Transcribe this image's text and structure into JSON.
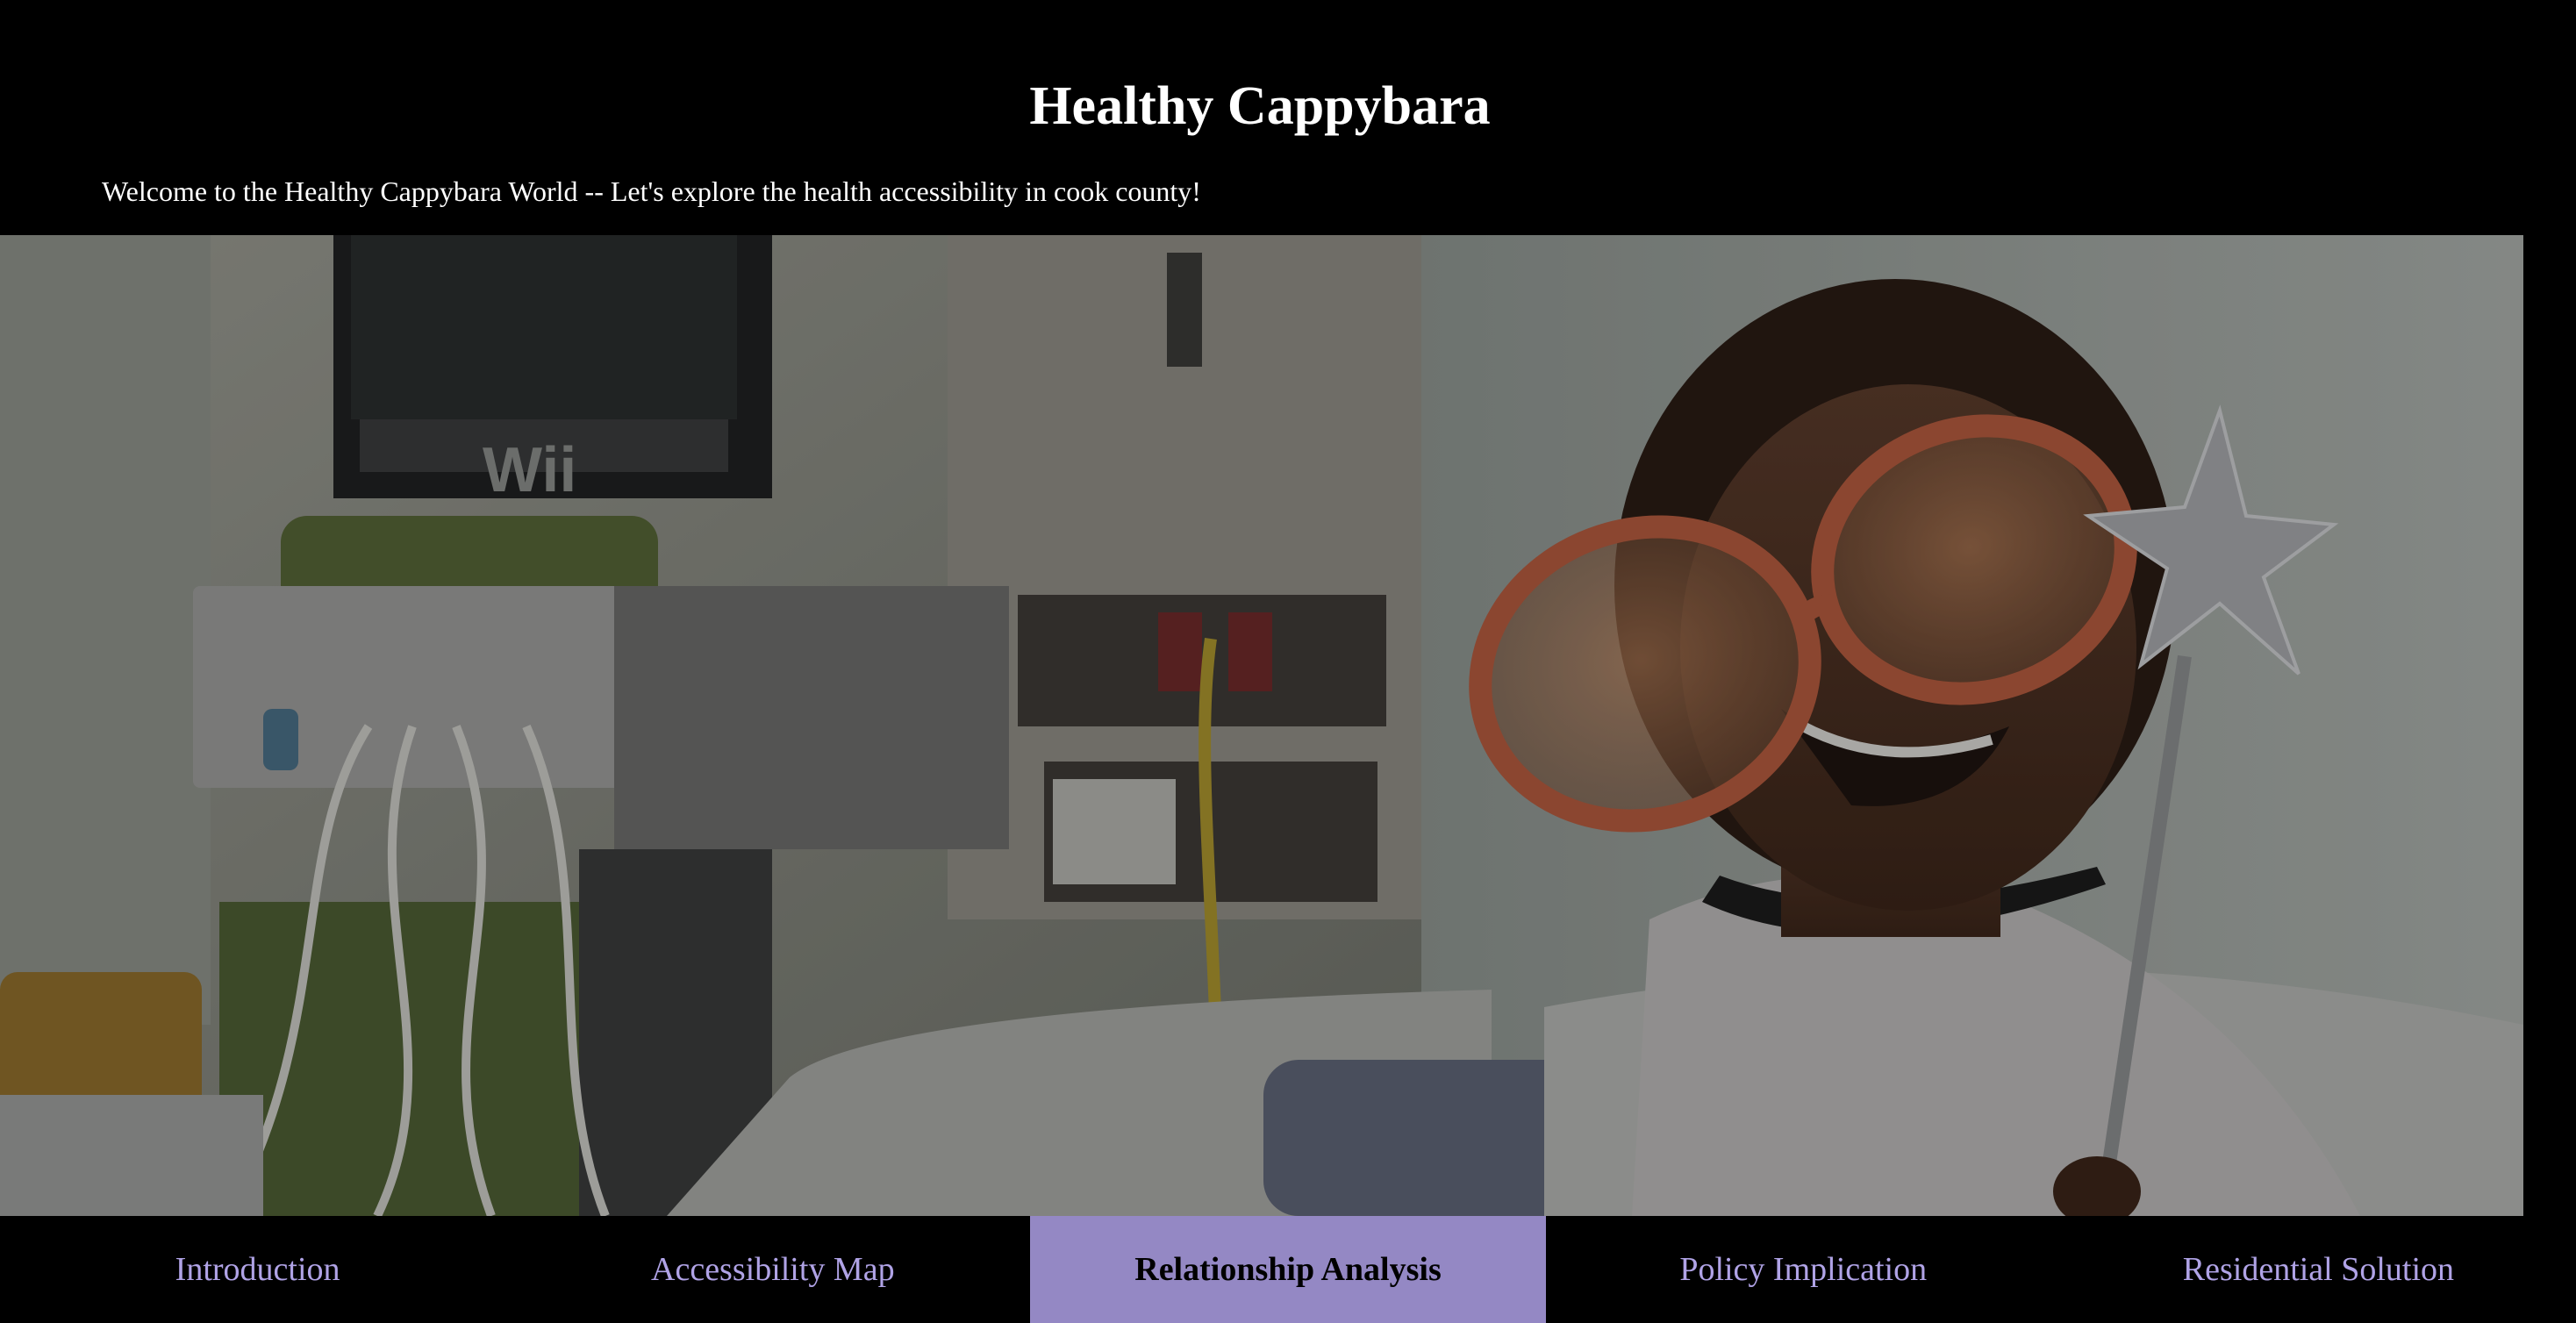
{
  "header": {
    "title": "Healthy Cappybara",
    "welcome": "Welcome to the Healthy Cappybara World -- Let's explore the health accessibility in cook county!"
  },
  "hero": {
    "image": "hero-photo",
    "monitor_label": "Wii"
  },
  "nav": {
    "items": [
      {
        "label": "Introduction",
        "active": false
      },
      {
        "label": "Accessibility Map",
        "active": false
      },
      {
        "label": "Relationship Analysis",
        "active": true
      },
      {
        "label": "Policy Implication",
        "active": false
      },
      {
        "label": "Residential Solution",
        "active": false
      }
    ]
  },
  "colors": {
    "background": "#000000",
    "nav_text": "#b0a3e6",
    "nav_active_bg": "#9488c4",
    "nav_active_text": "#000000"
  }
}
